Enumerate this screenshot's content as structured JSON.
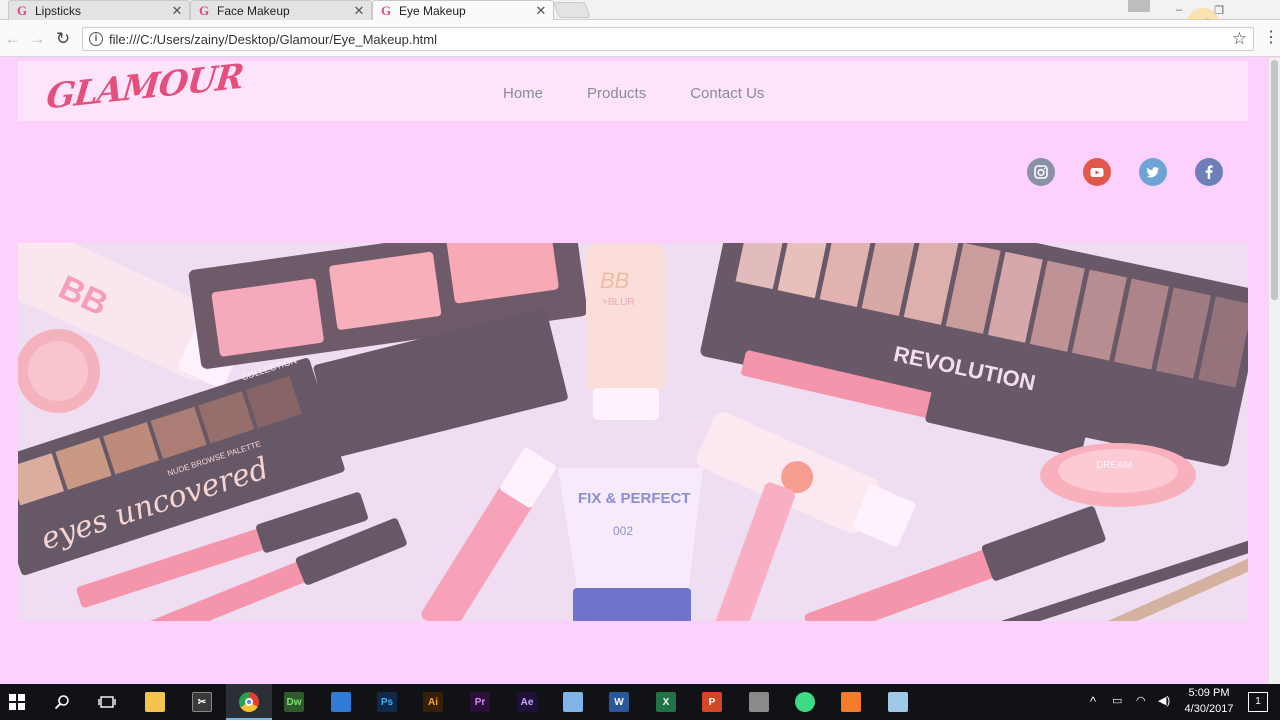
{
  "browser": {
    "tabs": [
      {
        "favicon": "G",
        "label": "Lipsticks",
        "active": false
      },
      {
        "favicon": "G",
        "label": "Face Makeup",
        "active": false
      },
      {
        "favicon": "G",
        "label": "Eye Makeup",
        "active": true
      }
    ],
    "tab_close_glyph": "✕",
    "url": "file:///C:/Users/zainy/Desktop/Glamour/Eye_Makeup.html",
    "icons": [
      "back-icon",
      "forward-icon",
      "reload-icon",
      "info-icon",
      "star-icon",
      "menu-icon"
    ]
  },
  "site": {
    "logo": "GLAMOUR",
    "nav": [
      {
        "label": "Home"
      },
      {
        "label": "Products"
      },
      {
        "label": "Contact Us"
      }
    ],
    "social": [
      {
        "name": "instagram",
        "color": "#8a90a6"
      },
      {
        "name": "youtube",
        "color": "#e2574c"
      },
      {
        "name": "twitter",
        "color": "#6ea3d6"
      },
      {
        "name": "facebook",
        "color": "#6c7fb8"
      }
    ],
    "colors": {
      "page_bg": "#fdd0fd",
      "header_bg": "#fde4fb",
      "nav_text": "#8b8b96",
      "logo": "#e44f7e"
    },
    "hero": {
      "printed_text": [
        "BB",
        "BB",
        "+BLUR",
        "REVOLUTION",
        "COLLECTION",
        "eyes uncovered",
        "NUDE BROWSE PALETTE",
        "FIX & PERFECT",
        "002",
        "DREAM"
      ]
    }
  },
  "taskbar": {
    "apps": [
      "start",
      "search",
      "task-view",
      "file-explorer",
      "tools",
      "chrome",
      "dreamweaver",
      "onedrive",
      "photoshop",
      "illustrator",
      "premiere",
      "after-effects",
      "3d-app",
      "word",
      "excel",
      "powerpoint",
      "media",
      "android-studio",
      "xampp",
      "notes"
    ],
    "time": "5:09 PM",
    "date": "4/30/2017",
    "notification_count": "1"
  }
}
